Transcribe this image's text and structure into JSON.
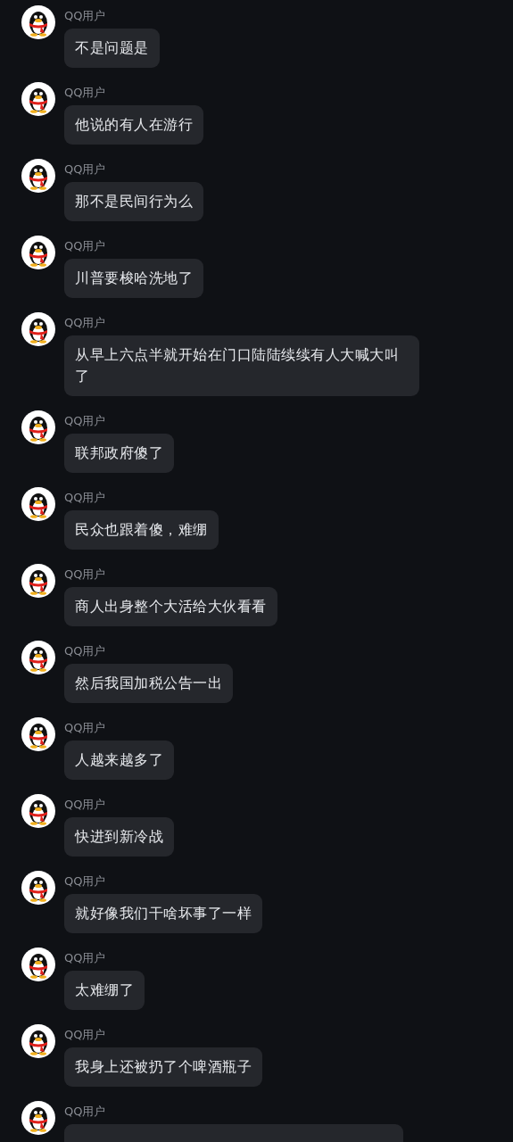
{
  "messages": [
    {
      "sender": "QQ用户",
      "text": "不是问题是"
    },
    {
      "sender": "QQ用户",
      "text": "他说的有人在游行"
    },
    {
      "sender": "QQ用户",
      "text": "那不是民间行为么"
    },
    {
      "sender": "QQ用户",
      "text": "川普要梭哈洗地了"
    },
    {
      "sender": "QQ用户",
      "text": "从早上六点半就开始在门口陆陆续续有人大喊大叫了"
    },
    {
      "sender": "QQ用户",
      "text": "联邦政府傻了"
    },
    {
      "sender": "QQ用户",
      "text": "民众也跟着傻，难绷"
    },
    {
      "sender": "QQ用户",
      "text": "商人出身整个大活给大伙看看"
    },
    {
      "sender": "QQ用户",
      "text": "然后我国加税公告一出"
    },
    {
      "sender": "QQ用户",
      "text": "人越来越多了"
    },
    {
      "sender": "QQ用户",
      "text": "快进到新冷战"
    },
    {
      "sender": "QQ用户",
      "text": "就好像我们干啥坏事了一样"
    },
    {
      "sender": "QQ用户",
      "text": "太难绷了"
    },
    {
      "sender": "QQ用户",
      "text": "我身上还被扔了个啤酒瓶子"
    },
    {
      "sender": "QQ用户",
      "kind": "cut"
    }
  ]
}
